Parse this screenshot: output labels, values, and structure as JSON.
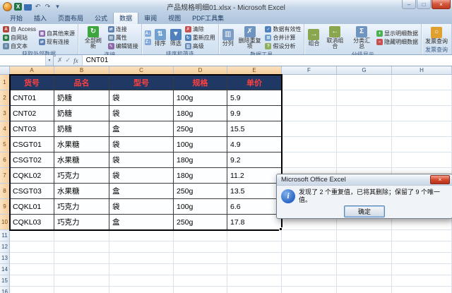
{
  "window": {
    "title": "产品规格明细01.xlsx - Microsoft Excel",
    "name_box": "",
    "formula": "CNT01"
  },
  "icons": {
    "minimize": "–",
    "restore": "□",
    "close": "×",
    "dropdown": "▾",
    "fx": "fx",
    "check": "✓",
    "cross": "✗",
    "info": "i",
    "undo": "↶",
    "redo": "↷",
    "excel": "X"
  },
  "ribbon": {
    "tabs": [
      {
        "label": "开始"
      },
      {
        "label": "插入"
      },
      {
        "label": "页面布局"
      },
      {
        "label": "公式"
      },
      {
        "label": "数据",
        "active": true
      },
      {
        "label": "审阅"
      },
      {
        "label": "视图"
      },
      {
        "label": "PDF工具集"
      }
    ],
    "groups": [
      {
        "name": "获取外部数据",
        "cols": [
          [
            {
              "label": "自 Access",
              "icon": "access-icon",
              "glyph": "A",
              "color": "#B04539"
            },
            {
              "label": "自网站",
              "icon": "website-icon",
              "glyph": "⊕",
              "color": "#2E7D46"
            },
            {
              "label": "自文本",
              "icon": "text-file-icon",
              "glyph": "≡",
              "color": "#6A88A8"
            }
          ],
          [
            {
              "label": "自其他来源",
              "icon": "other-sources-icon",
              "glyph": "▦",
              "color": "#8A68A8"
            },
            {
              "label": "现有连接",
              "icon": "existing-connections-icon",
              "glyph": "⇄",
              "color": "#5A7FB0"
            }
          ]
        ]
      },
      {
        "name": "连接",
        "cols": [
          [
            {
              "label": "全部刷新",
              "icon": "refresh-all-icon",
              "glyph": "↻",
              "color": "#3FA53F",
              "big": true
            }
          ],
          [
            {
              "label": "连接",
              "icon": "connections-icon",
              "glyph": "⇄",
              "color": "#5A7FB0"
            },
            {
              "label": "属性",
              "icon": "properties-icon",
              "glyph": "▤",
              "color": "#6A88A8"
            },
            {
              "label": "编辑链接",
              "icon": "edit-links-icon",
              "glyph": "✎",
              "color": "#8A68A8"
            }
          ]
        ]
      },
      {
        "name": "排序和筛选",
        "cols": [
          [
            {
              "label": "",
              "icon": "sort-az-icon",
              "glyph": "A↓",
              "color": "#7FA7D8"
            },
            {
              "label": "",
              "icon": "sort-za-icon",
              "glyph": "Z↓",
              "color": "#7FA7D8"
            }
          ],
          [
            {
              "label": "排序",
              "icon": "sort-icon",
              "glyph": "⇅",
              "color": "#6FA0D0",
              "big": true
            }
          ],
          [
            {
              "label": "筛选",
              "icon": "filter-icon",
              "glyph": "▼",
              "color": "#4F81BD",
              "big": true
            }
          ],
          [
            {
              "label": "清除",
              "icon": "clear-icon",
              "glyph": "✗",
              "color": "#C75050"
            },
            {
              "label": "重新应用",
              "icon": "reapply-icon",
              "glyph": "↻",
              "color": "#4F81BD"
            },
            {
              "label": "高级",
              "icon": "advanced-icon",
              "glyph": "▥",
              "color": "#6B8CB8"
            }
          ]
        ]
      },
      {
        "name": "数据工具",
        "cols": [
          [
            {
              "label": "分列",
              "icon": "text-to-columns-icon",
              "glyph": "▥",
              "color": "#7A9CC6",
              "big": true
            }
          ],
          [
            {
              "label": "删除重复项",
              "icon": "remove-duplicates-icon",
              "glyph": "✗",
              "color": "#6F94C0",
              "big": true
            }
          ],
          [
            {
              "label": "数据有效性",
              "icon": "data-validation-icon",
              "glyph": "✓",
              "color": "#4F81BD"
            },
            {
              "label": "合并计算",
              "icon": "consolidate-icon",
              "glyph": "⊞",
              "color": "#6FA0D0"
            },
            {
              "label": "假设分析",
              "icon": "what-if-icon",
              "glyph": "?",
              "color": "#8FAF5F"
            }
          ]
        ]
      },
      {
        "name": "分级显示",
        "cols": [
          [
            {
              "label": "组合",
              "icon": "group-icon",
              "glyph": "→",
              "color": "#8AA64F",
              "big": true
            }
          ],
          [
            {
              "label": "取消组合",
              "icon": "ungroup-icon",
              "glyph": "←",
              "color": "#8AA64F",
              "big": true
            }
          ],
          [
            {
              "label": "分类汇总",
              "icon": "subtotal-icon",
              "glyph": "Σ",
              "color": "#6F94C0",
              "big": true
            }
          ],
          [
            {
              "label": "显示明细数据",
              "icon": "show-detail-icon",
              "glyph": "+",
              "color": "#4CAF50"
            },
            {
              "label": "隐藏明细数据",
              "icon": "hide-detail-icon",
              "glyph": "−",
              "color": "#C75050"
            }
          ]
        ]
      },
      {
        "name": "发票查询",
        "cols": [
          [
            {
              "label": "发票查询",
              "icon": "invoice-search-icon",
              "glyph": "○",
              "color": "#E0A030",
              "big": true
            }
          ]
        ]
      }
    ]
  },
  "sheet": {
    "columns": [
      "A",
      "B",
      "C",
      "D",
      "E",
      "F",
      "G",
      "H"
    ],
    "table": {
      "headers": [
        "货号",
        "品名",
        "型号",
        "规格",
        "单价"
      ],
      "rows": [
        [
          "CNT01",
          "奶糖",
          "袋",
          "100g",
          "5.9"
        ],
        [
          "CNT02",
          "奶糖",
          "袋",
          "180g",
          "9.9"
        ],
        [
          "CNT03",
          "奶糖",
          "盒",
          "250g",
          "15.5"
        ],
        [
          "CSGT01",
          "水果糖",
          "袋",
          "100g",
          "4.9"
        ],
        [
          "CSGT02",
          "水果糖",
          "袋",
          "180g",
          "9.2"
        ],
        [
          "CQKL02",
          "巧克力",
          "袋",
          "180g",
          "11.2"
        ],
        [
          "CSGT03",
          "水果糖",
          "盒",
          "250g",
          "13.5"
        ],
        [
          "CQKL01",
          "巧克力",
          "袋",
          "100g",
          "6.6"
        ],
        [
          "CQKL03",
          "巧克力",
          "盒",
          "250g",
          "17.8"
        ]
      ],
      "header_bg": "#1F3864",
      "header_text_color": "#FF4040"
    }
  },
  "dialog": {
    "title": "Microsoft Office Excel",
    "message": "发现了 2 个重复值，已将其删除；保留了 9 个唯一值。",
    "ok_label": "确定"
  }
}
